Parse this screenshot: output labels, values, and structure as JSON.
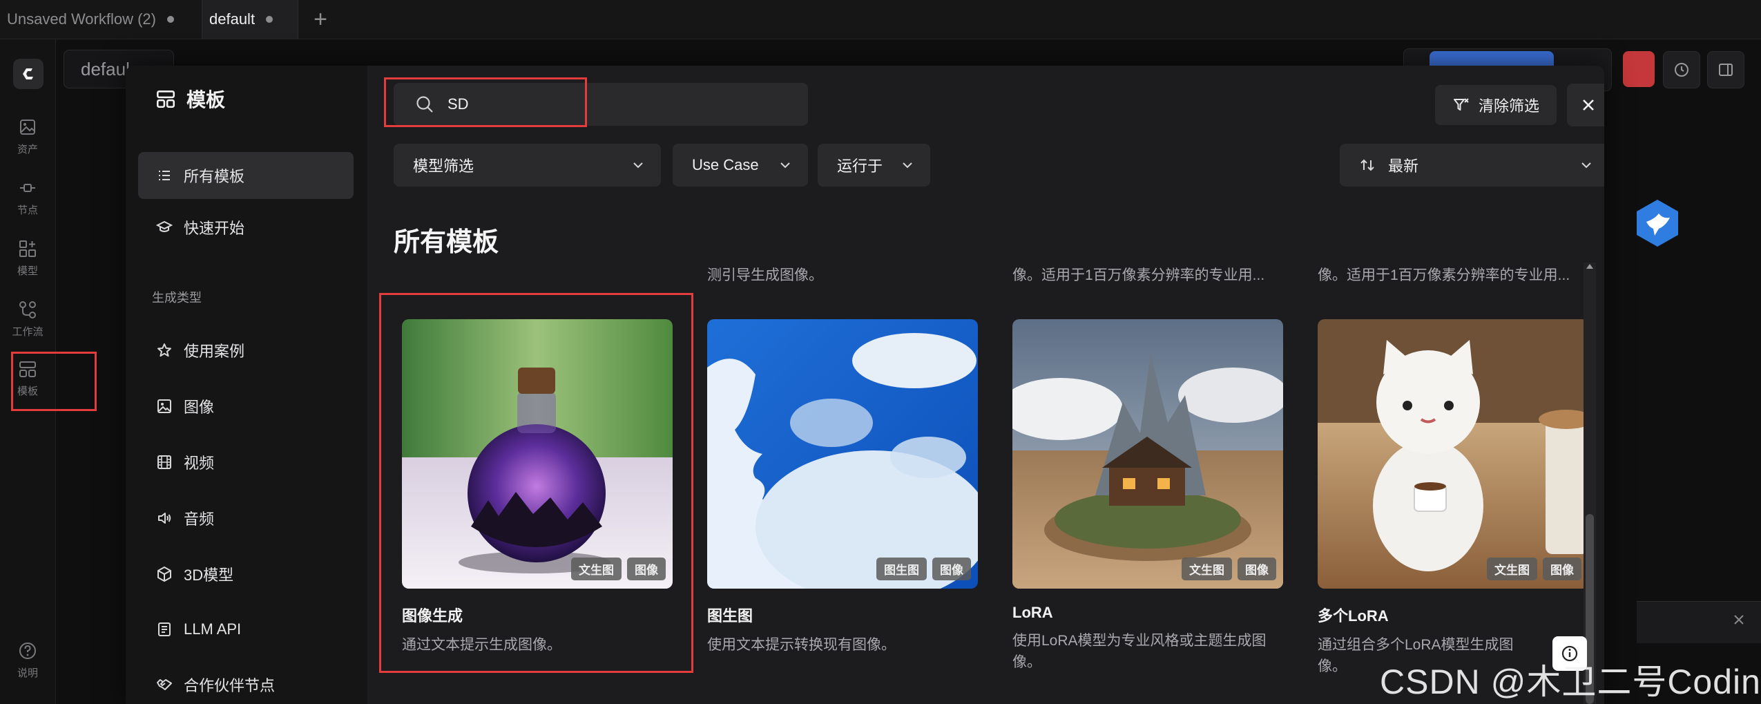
{
  "app_tabs": [
    {
      "label": "Unsaved Workflow (2)"
    },
    {
      "label": "default"
    }
  ],
  "rail": {
    "items": [
      {
        "label": "资产",
        "icon": "image-icon"
      },
      {
        "label": "节点",
        "icon": "node-icon"
      },
      {
        "label": "模型",
        "icon": "model-icon"
      },
      {
        "label": "工作流",
        "icon": "workflow-icon"
      },
      {
        "label": "模板",
        "icon": "template-icon"
      }
    ],
    "help_label": "说明"
  },
  "workspace": {
    "tab_label": "defaul"
  },
  "modal": {
    "title": "模板",
    "nav": [
      {
        "label": "所有模板",
        "icon": "list-icon",
        "active": true
      },
      {
        "label": "快速开始",
        "icon": "graduation-cap-icon",
        "active": false
      }
    ],
    "category_label": "生成类型",
    "categories": [
      {
        "label": "使用案例",
        "icon": "star-icon"
      },
      {
        "label": "图像",
        "icon": "image-icon"
      },
      {
        "label": "视频",
        "icon": "film-icon"
      },
      {
        "label": "音频",
        "icon": "speaker-icon"
      },
      {
        "label": "3D模型",
        "icon": "cube-icon"
      },
      {
        "label": "LLM API",
        "icon": "document-icon"
      },
      {
        "label": "合作伙伴节点",
        "icon": "handshake-icon"
      }
    ],
    "search": {
      "value": "SD"
    },
    "clear_filters_label": "清除筛选",
    "filters": {
      "model": "模型筛选",
      "use_case": "Use Case",
      "runs_on": "运行于",
      "sort": "最新"
    },
    "section_title": "所有模板",
    "prev_row_descriptions": [
      "测引导生成图像。",
      "像。适用于1百万像素分辨率的专业用...",
      "像。适用于1百万像素分辨率的专业用..."
    ],
    "cards": [
      {
        "title": "图像生成",
        "description": "通过文本提示生成图像。",
        "badges": [
          "文生图",
          "图像"
        ]
      },
      {
        "title": "图生图",
        "description": "使用文本提示转换现有图像。",
        "badges": [
          "图生图",
          "图像"
        ]
      },
      {
        "title": "LoRA",
        "description": "使用LoRA模型为专业风格或主题生成图像。",
        "badges": [
          "文生图",
          "图像"
        ]
      },
      {
        "title": "多个LoRA",
        "description": "通过组合多个LoRA模型生成图像。",
        "badges": [
          "文生图",
          "图像"
        ]
      }
    ]
  },
  "watermark": "CSDN @木卫二号Coding",
  "colors": {
    "highlight": "#e23c3c",
    "modal_bg": "#1c1c1e",
    "sidebar_bg": "#151516"
  }
}
